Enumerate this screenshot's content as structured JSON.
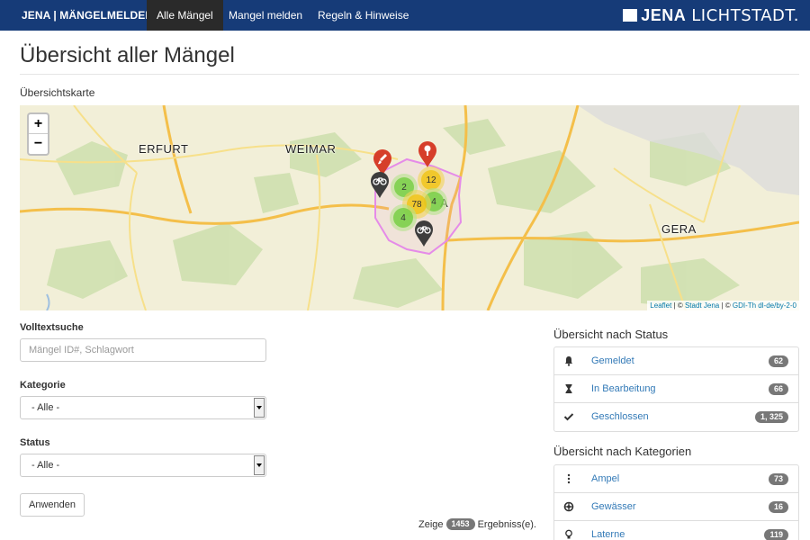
{
  "navbar": {
    "brand": "JENA | MÄNGELMELDER",
    "items": [
      {
        "label": "Alle Mängel",
        "active": true
      },
      {
        "label": "Mangel melden",
        "active": false
      },
      {
        "label": "Regeln & Hinweise",
        "active": false
      }
    ],
    "logo_bold": "JENA",
    "logo_light": "LICHTSTADT."
  },
  "page": {
    "title": "Übersicht aller Mängel",
    "map_heading": "Übersichtskarte"
  },
  "map": {
    "zoom_in": "+",
    "zoom_out": "−",
    "cities": {
      "erfurt": "ERFURT",
      "weimar": "WEIMAR",
      "gera": "GERA",
      "jena_fragment": "A"
    },
    "clusters": {
      "c2": "2",
      "c12": "12",
      "c78": "78",
      "c4a": "4",
      "c4b": "4"
    },
    "attribution": {
      "leaflet": "Leaflet",
      "sep1": " | © ",
      "stadt": "Stadt Jena",
      "sep2": " | © ",
      "gdi": "GDI-Th dl-de/by-2-0"
    }
  },
  "form": {
    "search_label": "Volltextsuche",
    "search_placeholder": "Mängel ID#, Schlagwort",
    "category_label": "Kategorie",
    "category_value": "- Alle -",
    "status_label": "Status",
    "status_value": "- Alle -",
    "apply_label": "Anwenden",
    "results_prefix": "Zeige",
    "results_count": "1453",
    "results_suffix": "Ergebniss(e)."
  },
  "status_panel": {
    "heading": "Übersicht nach Status",
    "items": [
      {
        "label": "Gemeldet",
        "count": "62",
        "icon": "bell-icon"
      },
      {
        "label": "In Bearbeitung",
        "count": "66",
        "icon": "hourglass-icon"
      },
      {
        "label": "Geschlossen",
        "count": "1, 325",
        "icon": "check-icon"
      }
    ]
  },
  "category_panel": {
    "heading": "Übersicht nach Kategorien",
    "items": [
      {
        "label": "Ampel",
        "count": "73",
        "icon": "traffic-light-icon"
      },
      {
        "label": "Gewässer",
        "count": "16",
        "icon": "lifebuoy-icon"
      },
      {
        "label": "Laterne",
        "count": "119",
        "icon": "lightbulb-icon"
      }
    ]
  },
  "colors": {
    "navbar": "#163b78",
    "nav_active": "#2a2a2a",
    "link": "#337ab7",
    "badge": "#777777",
    "marker_red": "#d63e2a",
    "marker_dark": "#3d3d3d",
    "boundary": "#e58be8"
  }
}
